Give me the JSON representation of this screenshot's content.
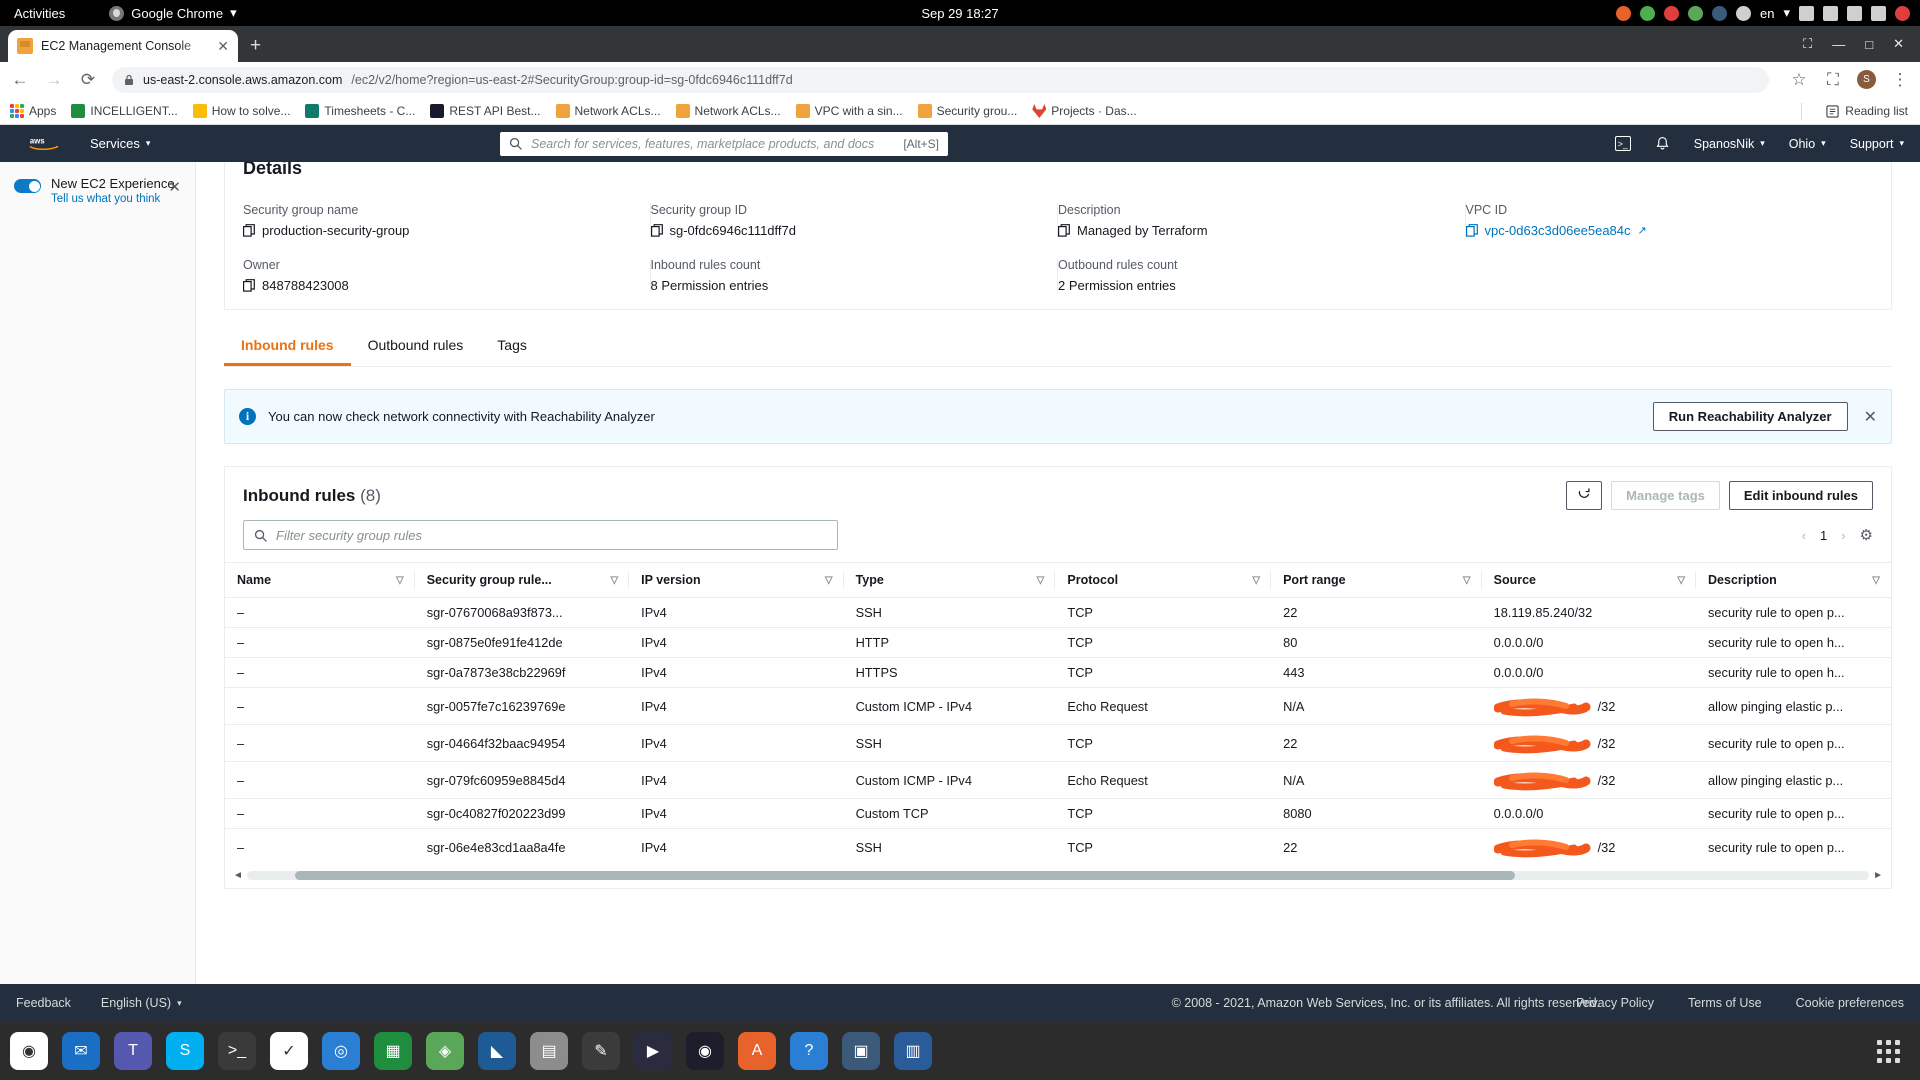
{
  "gnome": {
    "activities": "Activities",
    "app_name": "Google Chrome",
    "app_caret": "▾",
    "clock": "Sep 29  18:27",
    "lang": "en",
    "lang_caret": "▾"
  },
  "chrome": {
    "tab_title": "EC2 Management Console",
    "tab_close": "✕",
    "new_tab": "+",
    "minimize": "—",
    "maximize": "□",
    "window_close": "✕",
    "back": "←",
    "forward": "→",
    "reload": "⟳",
    "lock": "🔒",
    "url_host": "us-east-2.console.aws.amazon.com",
    "url_rest": "/ec2/v2/home?region=us-east-2#SecurityGroup:group-id=sg-0fdc6946c111dff7d",
    "star": "☆",
    "extensions": "⛶",
    "avatar_letter": "S",
    "menu": "⋮",
    "bookmarks": [
      {
        "label": "Apps",
        "icon": "apps-grid-icon",
        "color": "#ea4335"
      },
      {
        "label": "INCELLIGENT...",
        "icon": "sheets-icon",
        "color": "#1e8e3e"
      },
      {
        "label": "How to solve...",
        "icon": "keep-icon",
        "color": "#fbbc04"
      },
      {
        "label": "Timesheets - C...",
        "icon": "sharepoint-icon",
        "color": "#0f7b6c"
      },
      {
        "label": "REST API Best...",
        "icon": "dark-icon",
        "color": "#1a1a2e"
      },
      {
        "label": "Network ACLs...",
        "icon": "aws-icon",
        "color": "#f0a33c"
      },
      {
        "label": "Network ACLs...",
        "icon": "aws-icon",
        "color": "#f0a33c"
      },
      {
        "label": "VPC with a sin...",
        "icon": "aws-icon",
        "color": "#f0a33c"
      },
      {
        "label": "Security grou...",
        "icon": "aws-icon",
        "color": "#f0a33c"
      },
      {
        "label": "Projects · Das...",
        "icon": "gitlab-icon",
        "color": "#e24329"
      }
    ],
    "reading_list": "Reading list"
  },
  "aws_nav": {
    "logo": "aws",
    "services": "Services",
    "services_caret": "▾",
    "search_placeholder": "Search for services, features, marketplace products, and docs",
    "search_shortcut": "[Alt+S]",
    "cloudshell_icon": "cloudshell-icon",
    "bell_icon": "bell-icon",
    "account": "SpanosNik",
    "account_caret": "▾",
    "region": "Ohio",
    "region_caret": "▾",
    "support": "Support",
    "support_caret": "▾"
  },
  "sidebar": {
    "toggle_label": "New EC2 Experience",
    "toggle_sub": "Tell us what you think",
    "close": "✕"
  },
  "details": {
    "heading": "Details",
    "fields": [
      {
        "label": "Security group name",
        "value": "production-security-group",
        "copy": true
      },
      {
        "label": "Security group ID",
        "value": "sg-0fdc6946c111dff7d",
        "copy": true
      },
      {
        "label": "Description",
        "value": "Managed by Terraform",
        "copy": true
      },
      {
        "label": "VPC ID",
        "value": "vpc-0d63c3d06ee5ea84c",
        "copy": true,
        "link": true,
        "external": "↗"
      },
      {
        "label": "Owner",
        "value": "848788423008",
        "copy": true
      },
      {
        "label": "Inbound rules count",
        "value": "8 Permission entries",
        "copy": false
      },
      {
        "label": "Outbound rules count",
        "value": "2 Permission entries",
        "copy": false
      }
    ]
  },
  "tabs": [
    {
      "label": "Inbound rules",
      "active": true
    },
    {
      "label": "Outbound rules",
      "active": false
    },
    {
      "label": "Tags",
      "active": false
    }
  ],
  "alert": {
    "icon": "info-icon",
    "text": "You can now check network connectivity with Reachability Analyzer",
    "button": "Run Reachability Analyzer",
    "close": "✕"
  },
  "rules_card": {
    "title": "Inbound rules",
    "count": "(8)",
    "refresh_icon": "refresh-icon",
    "manage_tags": "Manage tags",
    "edit_rules": "Edit inbound rules",
    "filter_placeholder": "Filter security group rules",
    "search_icon": "search-icon",
    "page_prev": "‹",
    "page_number": "1",
    "page_next": "›",
    "settings_icon": "gear-icon",
    "columns": [
      {
        "label": "Name",
        "sortable": true
      },
      {
        "label": "Security group rule...",
        "sortable": true
      },
      {
        "label": "IP version",
        "sortable": true
      },
      {
        "label": "Type",
        "sortable": true
      },
      {
        "label": "Protocol",
        "sortable": true
      },
      {
        "label": "Port range",
        "sortable": true
      },
      {
        "label": "Source",
        "sortable": true
      },
      {
        "label": "Description",
        "sortable": true
      }
    ],
    "rows": [
      {
        "name": "–",
        "rule_id": "sgr-07670068a93f873...",
        "ip_version": "IPv4",
        "type": "SSH",
        "protocol": "TCP",
        "port": "22",
        "source": "18.119.85.240/32",
        "source_redacted": false,
        "description": "security rule to open p..."
      },
      {
        "name": "–",
        "rule_id": "sgr-0875e0fe91fe412de",
        "ip_version": "IPv4",
        "type": "HTTP",
        "protocol": "TCP",
        "port": "80",
        "source": "0.0.0.0/0",
        "source_redacted": false,
        "description": "security rule to open h..."
      },
      {
        "name": "–",
        "rule_id": "sgr-0a7873e38cb22969f",
        "ip_version": "IPv4",
        "type": "HTTPS",
        "protocol": "TCP",
        "port": "443",
        "source": "0.0.0.0/0",
        "source_redacted": false,
        "description": "security rule to open h..."
      },
      {
        "name": "–",
        "rule_id": "sgr-0057fe7c16239769e",
        "ip_version": "IPv4",
        "type": "Custom ICMP - IPv4",
        "protocol": "Echo Request",
        "port": "N/A",
        "source": "/32",
        "source_redacted": true,
        "description": "allow pinging elastic p..."
      },
      {
        "name": "–",
        "rule_id": "sgr-04664f32baac94954",
        "ip_version": "IPv4",
        "type": "SSH",
        "protocol": "TCP",
        "port": "22",
        "source": "/32",
        "source_redacted": true,
        "description": "security rule to open p..."
      },
      {
        "name": "–",
        "rule_id": "sgr-079fc60959e8845d4",
        "ip_version": "IPv4",
        "type": "Custom ICMP - IPv4",
        "protocol": "Echo Request",
        "port": "N/A",
        "source": "/32",
        "source_redacted": true,
        "description": "allow pinging elastic p..."
      },
      {
        "name": "–",
        "rule_id": "sgr-0c40827f020223d99",
        "ip_version": "IPv4",
        "type": "Custom TCP",
        "protocol": "TCP",
        "port": "8080",
        "source": "0.0.0.0/0",
        "source_redacted": false,
        "description": "security rule to open p..."
      },
      {
        "name": "–",
        "rule_id": "sgr-06e4e83cd1aa8a4fe",
        "ip_version": "IPv4",
        "type": "SSH",
        "protocol": "TCP",
        "port": "22",
        "source": "/32",
        "source_redacted": true,
        "description": "security rule to open p..."
      }
    ]
  },
  "footer": {
    "feedback": "Feedback",
    "language": "English (US)",
    "language_caret": "▾",
    "copyright": "© 2008 - 2021, Amazon Web Services, Inc. or its affiliates. All rights reserved.",
    "privacy": "Privacy Policy",
    "terms": "Terms of Use",
    "cookies": "Cookie preferences"
  },
  "taskbar": {
    "items": [
      {
        "name": "chrome",
        "color": "#ffffff",
        "glyph": "◉"
      },
      {
        "name": "thunderbird",
        "color": "#1a6fc4",
        "glyph": "✉"
      },
      {
        "name": "teams",
        "color": "#5558af",
        "glyph": "T"
      },
      {
        "name": "skype",
        "color": "#00aff0",
        "glyph": "S"
      },
      {
        "name": "terminal",
        "color": "#3a3a3a",
        "glyph": ">_"
      },
      {
        "name": "todoist",
        "color": "#ffffff",
        "glyph": "✓"
      },
      {
        "name": "firefox",
        "color": "#2a7fd4",
        "glyph": "◎"
      },
      {
        "name": "calc",
        "color": "#1e8e3e",
        "glyph": "▦"
      },
      {
        "name": "mint",
        "color": "#5aa75a",
        "glyph": "◈"
      },
      {
        "name": "vscode",
        "color": "#1e5b94",
        "glyph": "◣"
      },
      {
        "name": "files",
        "color": "#8d8d8d",
        "glyph": "▤"
      },
      {
        "name": "editor",
        "color": "#3b3b3b",
        "glyph": "✎"
      },
      {
        "name": "postman",
        "color": "#2b2b40",
        "glyph": "▶"
      },
      {
        "name": "obs",
        "color": "#1d1d2b",
        "glyph": "◉"
      },
      {
        "name": "ubuntu-software",
        "color": "#e8622c",
        "glyph": "A"
      },
      {
        "name": "help",
        "color": "#2a7fd4",
        "glyph": "?"
      },
      {
        "name": "virtualbox",
        "color": "#3b5a7a",
        "glyph": "▣"
      },
      {
        "name": "writer",
        "color": "#2a5c9a",
        "glyph": "▥"
      }
    ]
  }
}
